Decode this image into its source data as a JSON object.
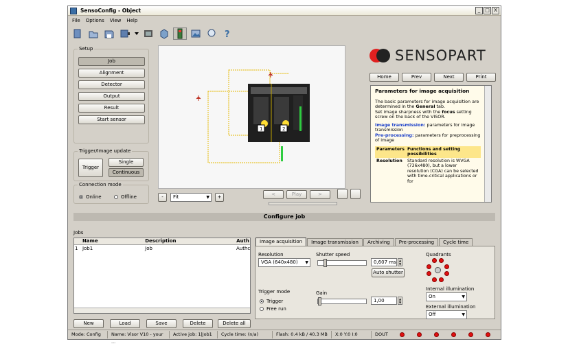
{
  "window": {
    "title": "SensoConfig - Object",
    "min": "_",
    "max": "□",
    "close": "X"
  },
  "menu": [
    "File",
    "Options",
    "View",
    "Help"
  ],
  "toolbar": [
    "new-icon",
    "open-icon",
    "save-icon",
    "device-icon",
    "dropdown-icon",
    "film-icon",
    "box-icon",
    "sensor-icon",
    "image-icon",
    "search-icon",
    "help-icon"
  ],
  "setup": {
    "legend": "Setup",
    "buttons": [
      "Job",
      "Alignment",
      "Detector",
      "Output",
      "Result",
      "Start sensor"
    ]
  },
  "trigger": {
    "legend": "Trigger/Image update",
    "trigger": "Trigger",
    "single": "Single",
    "continuous": "Continuous"
  },
  "connection": {
    "legend": "Connection mode",
    "online": "Online",
    "offline": "Offline"
  },
  "viewer": {
    "zoom_minus": "-",
    "zoom_value": "Fit",
    "zoom_plus": "+",
    "prev": "<",
    "play": "Play",
    "next": ">",
    "label1": "1",
    "label2": "2"
  },
  "brand": {
    "logo_text": "SENSOPART"
  },
  "help_nav": {
    "home": "Home",
    "prev": "Prev",
    "next": "Next",
    "print": "Print"
  },
  "help": {
    "title": "Parameters for image acquisition",
    "p1_a": "The basic parameters for image acquisition are determined in the ",
    "p1_b": "General",
    "p1_c": " tab.",
    "p2_a": "Set image sharpness with the ",
    "p2_b": "focus",
    "p2_c": " setting screw on the back of the VISOR.",
    "l1": "Image transmission:",
    "l1t": " parameters for image transmission",
    "l2": "Pre-processing:",
    "l2t": " parameters for preprocessing of image",
    "th1": "Parameters",
    "th2": "Functions and setting possibilities",
    "r1": "Resolution",
    "r2": "Standard resolution is WVGA (736x480), but a lower resolution (CGA) can be selected with time-critical applications or for"
  },
  "section": {
    "title": "Configure job"
  },
  "jobs": {
    "label": "Jobs",
    "headers": [
      "Name",
      "Description",
      "Auth"
    ],
    "rows": [
      {
        "idx": "1",
        "name": "Job1",
        "desc": "Job",
        "auth": "Authc"
      }
    ],
    "buttons": [
      "New",
      "Load",
      "Save",
      "Delete",
      "Delete all"
    ]
  },
  "tabs": [
    "Image acquisition",
    "Image transmission",
    "Archiving",
    "Pre-processing",
    "Cycle time"
  ],
  "acq": {
    "resolution_label": "Resolution",
    "resolution_value": "VGA (640x480)",
    "shutter_label": "Shutter speed",
    "shutter_value": "0,607 ms",
    "shutter_fraction": 0.12,
    "auto_shutter": "Auto shutter",
    "trigger_mode_label": "Trigger mode",
    "trigger_opt": "Trigger",
    "freerun_opt": "Free run",
    "gain_label": "Gain",
    "gain_value": "1,00",
    "gain_fraction": 0.0,
    "quadrants_label": "Quadrants",
    "internal_label": "Internal illumination",
    "internal_value": "On",
    "external_label": "External illumination",
    "external_value": "Off"
  },
  "status": {
    "mode": "Mode:  Config",
    "name": "Name:  Visor V10 - your ...",
    "active": "Active job:  1|Job1",
    "cycle": "Cycle time:  (n/a)",
    "flash": "Flash:  0.4 kB / 40.3 MB",
    "xy": "X:0 Y:0 I:0",
    "dout": "DOUT"
  },
  "colors": {
    "led": "#e01010",
    "help_bg": "#fffbea",
    "table_head": "#fde68a",
    "link": "#1a3ec8"
  }
}
